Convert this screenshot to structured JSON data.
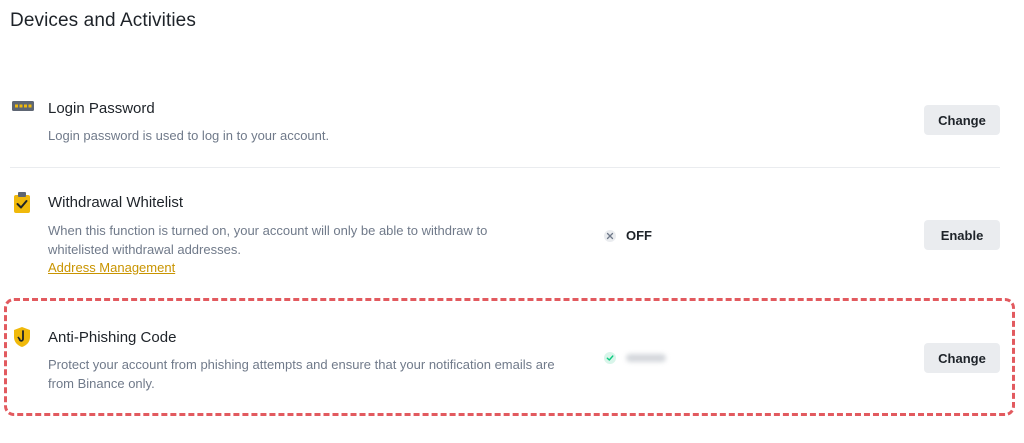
{
  "page": {
    "title": "Devices and Activities"
  },
  "items": [
    {
      "icon": "password-dots-icon",
      "title": "Login Password",
      "description": "Login password is used to log in to your account.",
      "button": "Change"
    },
    {
      "icon": "clipboard-check-icon",
      "title": "Withdrawal Whitelist",
      "description": "When this function is turned on, your account will only be able to withdraw to whitelisted withdrawal addresses.",
      "link": "Address Management",
      "status": {
        "icon": "cross-icon",
        "text": "OFF"
      },
      "button": "Enable"
    },
    {
      "icon": "shield-hook-icon",
      "title": "Anti-Phishing Code",
      "description": "Protect your account from phishing attempts and ensure that your notification emails are from Binance only.",
      "status": {
        "icon": "check-icon"
      },
      "button": "Change"
    }
  ],
  "colors": {
    "accent": "#f0b90b",
    "link": "#c99400",
    "highlight": "#e25a5f",
    "success": "#0ecb81"
  }
}
